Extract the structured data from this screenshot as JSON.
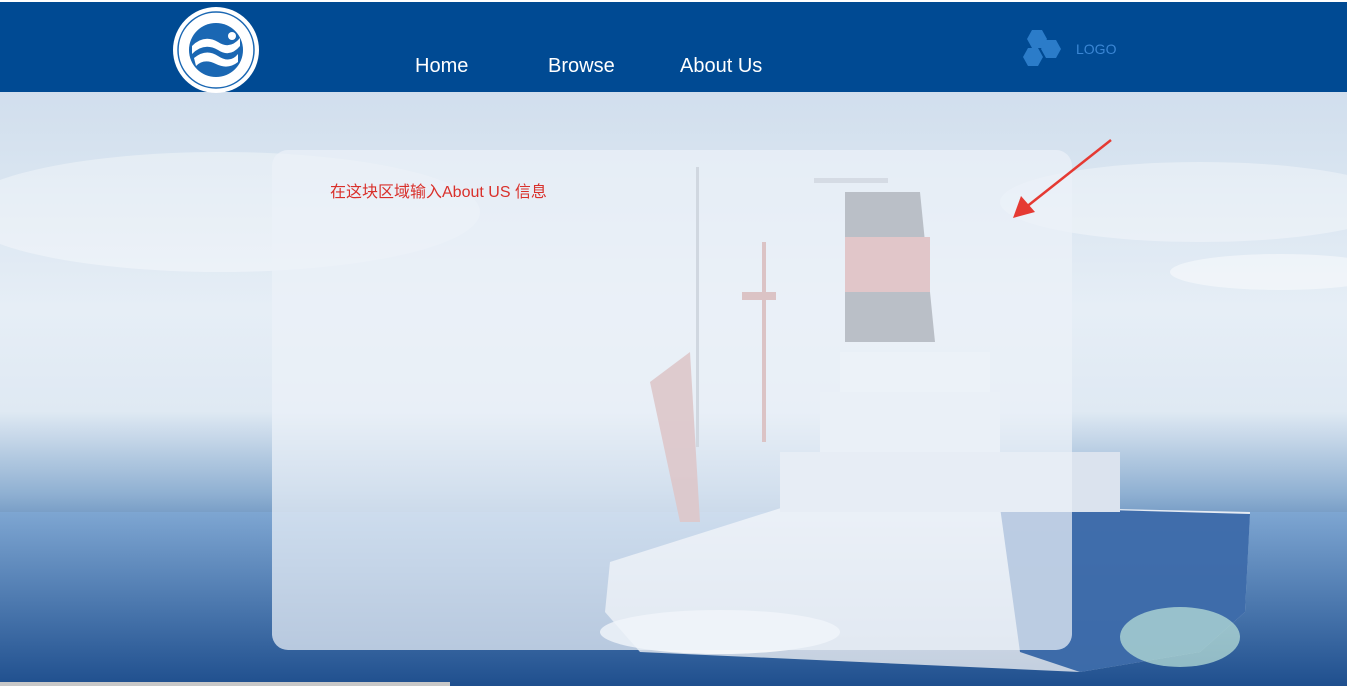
{
  "header": {
    "emblem_icon": "institute-emblem-icon",
    "nav": {
      "home": "Home",
      "browse": "Browse",
      "about": "About Us"
    },
    "logo": {
      "icon": "hexagon-cluster-icon",
      "text": "LOGO"
    }
  },
  "main": {
    "panel_text": "在这块区域输入About US 信息"
  },
  "colors": {
    "header_bg": "#004a93",
    "nav_text": "#ffffff",
    "logo_text": "#3a86d4",
    "panel_text": "#d9302b",
    "arrow": "#e53a33"
  }
}
